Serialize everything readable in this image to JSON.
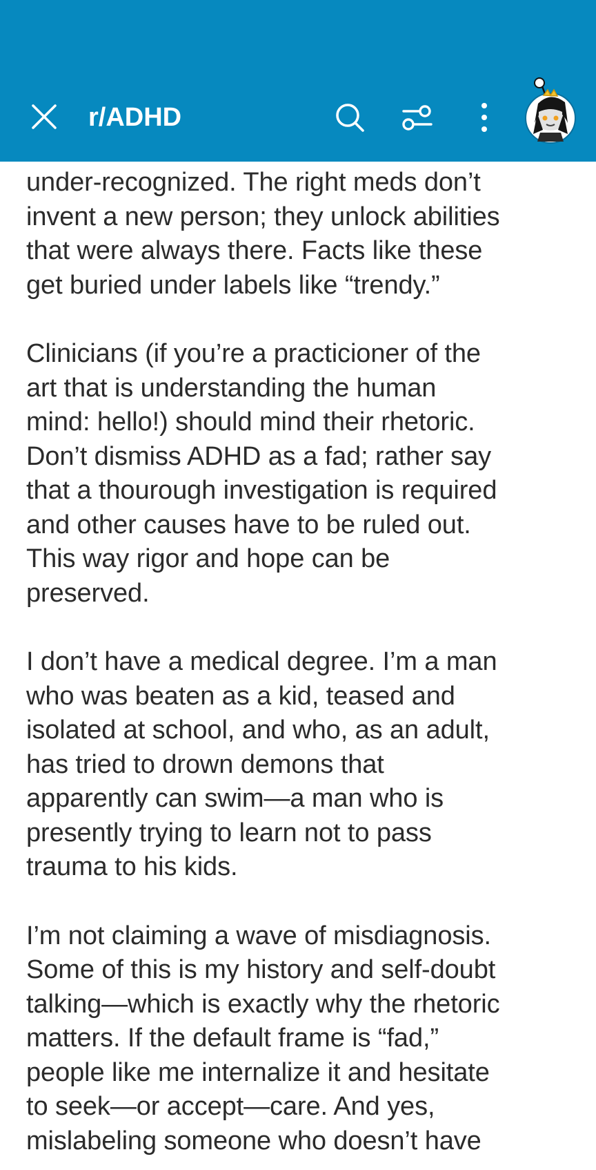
{
  "header": {
    "subreddit": "r/ADHD",
    "background_color": "#0689bf",
    "close_icon": "close-icon",
    "search_icon": "search-icon",
    "filter_icon": "filter-sliders-icon",
    "more_icon": "more-vertical-icon",
    "avatar": "user-avatar"
  },
  "post": {
    "paragraphs": [
      {
        "lines": [
          "under-recognized. The right meds don’t",
          "invent a new person; they unlock abilities",
          "that were always there. Facts like these",
          "get buried under labels like “trendy.”"
        ]
      },
      {
        "lines": [
          "Clinicians (if you’re a practicioner of the",
          "art that is understanding the human",
          "mind: hello!) should mind their rhetoric.",
          "Don’t dismiss ADHD as a fad; rather say",
          "that a thourough investigation is required",
          "and other causes have to be ruled out.",
          "This way rigor and hope can be",
          "preserved."
        ]
      },
      {
        "lines": [
          "I don’t have a medical degree. I’m a man",
          "who was beaten as a kid, teased and",
          "isolated at school, and who, as an adult,",
          "has tried to drown demons that",
          "apparently can swim—a man who is",
          "presently trying to learn not to pass",
          "trauma to his kids."
        ]
      },
      {
        "lines": [
          "I’m not claiming a wave of misdiagnosis.",
          "Some of this is my history and self-doubt",
          "talking—which is exactly why the rhetoric",
          "matters. If the default frame is “fad,”",
          "people like me internalize it and hesitate",
          "to seek—or accept—care. And yes,",
          "mislabeling someone who doesn’t have"
        ]
      }
    ]
  }
}
